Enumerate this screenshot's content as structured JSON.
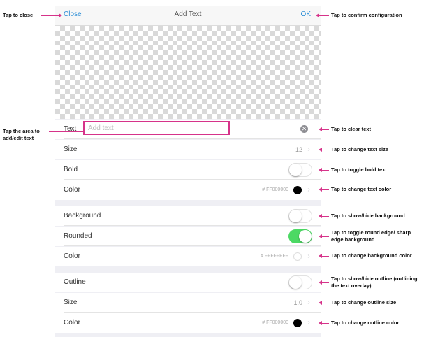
{
  "nav": {
    "close": "Close",
    "title": "Add Text",
    "ok": "OK"
  },
  "text_row": {
    "label": "Text",
    "placeholder": "Add text"
  },
  "size_row": {
    "label": "Size",
    "value": "12"
  },
  "bold_row": {
    "label": "Bold",
    "on": false
  },
  "color_row": {
    "label": "Color",
    "hex": "# FF000000",
    "swatch": "#000000"
  },
  "background_row": {
    "label": "Background",
    "on": false
  },
  "rounded_row": {
    "label": "Rounded",
    "on": true
  },
  "bg_color_row": {
    "label": "Color",
    "hex": "# FFFFFFFF",
    "swatch": "#ffffff"
  },
  "outline_row": {
    "label": "Outline",
    "on": false
  },
  "outline_size_row": {
    "label": "Size",
    "value": "1.0"
  },
  "outline_color_row": {
    "label": "Color",
    "hex": "# FF000000",
    "swatch": "#000000"
  },
  "annotations": {
    "tap_to_close": "Tap to close",
    "tap_area_edit": "Tap the area to add/edit text",
    "confirm": "Tap to confirm configuration",
    "clear_text": "Tap to clear text",
    "change_text_size": "Tap to change text size",
    "toggle_bold": "Tap to toggle bold text",
    "change_text_color": "Tap to change text color",
    "show_hide_bg": "Tap to show/hide background",
    "toggle_round": "Tap to toggle round edge/ sharp edge background",
    "change_bg_color": "Tap to change background color",
    "show_hide_outline": "Tap to show/hide outline (outlining the text overlay)",
    "change_outline_size": "Tap to change outline size",
    "change_outline_color": "Tap to change outline color"
  },
  "colors": {
    "accent": "#2e8fd6",
    "annotation": "#d6338a",
    "toggle_on": "#4cd964"
  }
}
